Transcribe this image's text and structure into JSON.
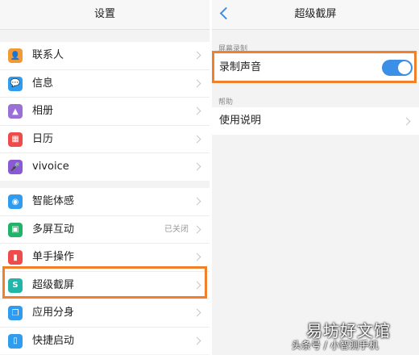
{
  "left": {
    "title": "设置",
    "group1": [
      {
        "label": "联系人",
        "icon": "contacts-icon",
        "color": "#f29a38",
        "glyph": "👤"
      },
      {
        "label": "信息",
        "icon": "message-icon",
        "color": "#2f9cf0",
        "glyph": "💬"
      },
      {
        "label": "相册",
        "icon": "album-icon",
        "color": "#9a6fd6",
        "glyph": "▲"
      },
      {
        "label": "日历",
        "icon": "calendar-icon",
        "color": "#f04b4b",
        "glyph": "▦"
      },
      {
        "label": "vivoice",
        "icon": "microphone-icon",
        "color": "#8a5ad6",
        "glyph": "🎤"
      }
    ],
    "group2": [
      {
        "label": "智能体感",
        "icon": "motion-icon",
        "color": "#2f9cf0",
        "glyph": "◉",
        "status": ""
      },
      {
        "label": "多屏互动",
        "icon": "multiscreen-icon",
        "color": "#21b36a",
        "glyph": "▣",
        "status": "已关闭"
      },
      {
        "label": "单手操作",
        "icon": "one-hand-icon",
        "color": "#f04b4b",
        "glyph": "▮",
        "status": ""
      },
      {
        "label": "超级截屏",
        "icon": "screenshot-icon",
        "color": "#21b6a8",
        "glyph": "S",
        "status": ""
      },
      {
        "label": "应用分身",
        "icon": "app-clone-icon",
        "color": "#2f9cf0",
        "glyph": "❐",
        "status": ""
      },
      {
        "label": "快捷启动",
        "icon": "quick-launch-icon",
        "color": "#2f9cf0",
        "glyph": "▯",
        "status": ""
      }
    ]
  },
  "right": {
    "title": "超级截屏",
    "section1_label": "屏幕录制",
    "record_sound_label": "录制声音",
    "record_sound_on": true,
    "section2_label": "帮助",
    "help_label": "使用说明"
  },
  "watermark": {
    "line1": "易坊好文馆",
    "line2": "头条号 / 小智测手机"
  },
  "colors": {
    "accent": "#3b8fe6",
    "highlight": "#f0812a"
  }
}
